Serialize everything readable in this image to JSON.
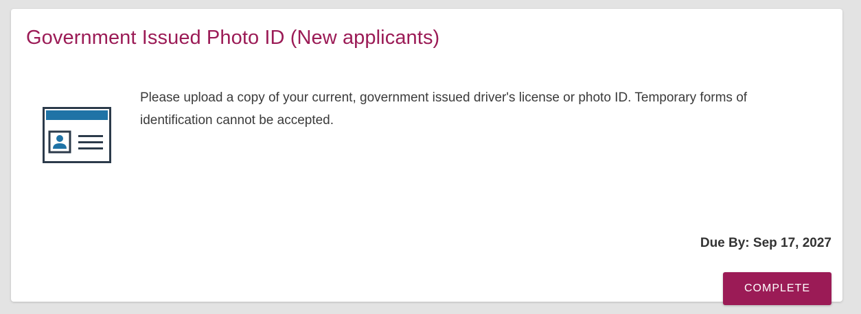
{
  "card": {
    "title": "Government Issued Photo ID (New applicants)",
    "icon": "id-card-icon",
    "description": "Please upload a copy of your current, government issued driver's license or photo ID. Temporary forms of identification cannot be accepted.",
    "due_label": "Due By: Sep 17, 2027",
    "complete_label": "COMPLETE"
  },
  "colors": {
    "accent": "#9b1b56",
    "icon_blue": "#1f73a6",
    "icon_dark": "#2b3a4a",
    "background": "#e3e3e3"
  }
}
